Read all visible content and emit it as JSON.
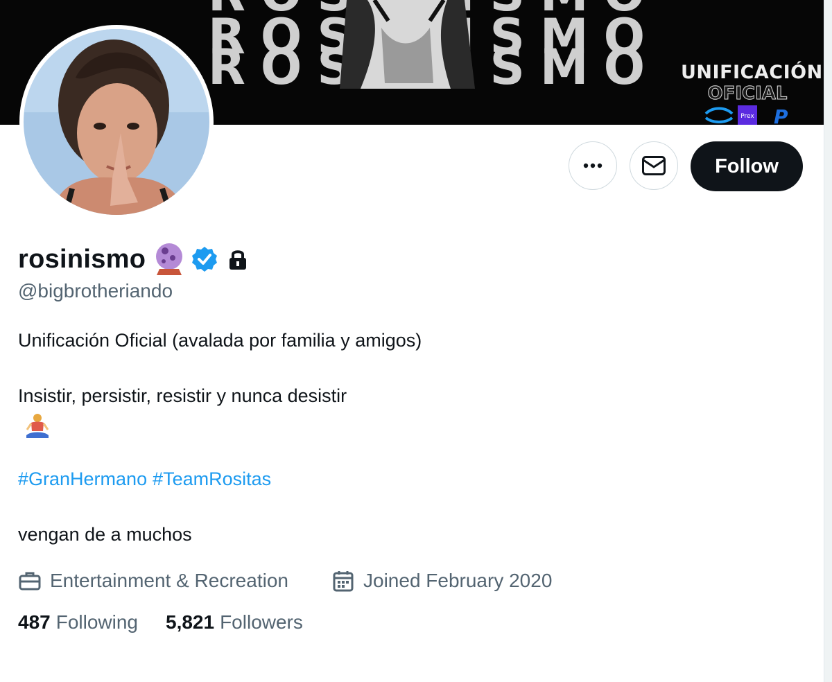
{
  "banner": {
    "repeated_word": "ROSINISMO",
    "brand_line1": "UNIFICACIÓN",
    "brand_line2": "OFICIAL",
    "badge_text": "Prex"
  },
  "profile": {
    "display_name": "rosinismo",
    "name_emoji": "crystal-ball",
    "verified": true,
    "protected": true,
    "handle": "@bigbrotheriando"
  },
  "actions": {
    "more_icon": "more-icon",
    "message_icon": "envelope-icon",
    "follow_label": "Follow"
  },
  "bio": {
    "line1": "Unificación Oficial (avalada por familia y amigos)",
    "line2": "Insistir, persistir, resistir y nunca desistir",
    "line2_emoji": "person-in-lotus-position",
    "hashtags": [
      "#GranHermano",
      "#TeamRositas"
    ],
    "line3": "vengan de a muchos"
  },
  "meta": {
    "category": "Entertainment & Recreation",
    "category_icon": "briefcase-icon",
    "joined": "Joined February 2020",
    "joined_icon": "calendar-icon"
  },
  "stats": {
    "following_count": "487",
    "following_label": "Following",
    "followers_count": "5,821",
    "followers_label": "Followers"
  },
  "colors": {
    "text_primary": "#0f1419",
    "text_secondary": "#536471",
    "link": "#1d9bf0",
    "follow_button": "#0f1419",
    "verified_badge": "#1d9bf0",
    "banner_bg": "#060606"
  }
}
